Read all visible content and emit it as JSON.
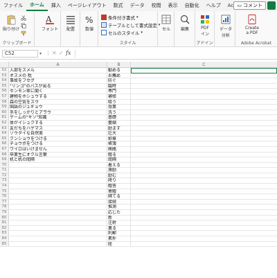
{
  "menu": {
    "items": [
      "ファイル",
      "ホーム",
      "挿入",
      "ページレイアウト",
      "数式",
      "データ",
      "校閲",
      "表示",
      "自動化",
      "ヘルプ",
      "Acrobat"
    ],
    "active_index": 1,
    "comment_label": "コメント"
  },
  "ribbon": {
    "clipboard": {
      "paste_label": "貼り付け",
      "group_label": "クリップボード"
    },
    "font": {
      "label": "フォント"
    },
    "alignment": {
      "label": "配置"
    },
    "number": {
      "label": "数値"
    },
    "styles": {
      "conditional": "条件付き書式",
      "table": "テーブルとして書式設定",
      "cellstyle": "セルのスタイル",
      "group_label": "スタイル"
    },
    "cells": {
      "label": "セル"
    },
    "editing": {
      "label": "編集"
    },
    "addin": {
      "label": "PDF\nイン",
      "group_label": "アドイン"
    },
    "analyze": {
      "label": "データ\n分析"
    },
    "acrobat": {
      "label": "Create\na PDF",
      "group_label": "Adobe Acrobat"
    }
  },
  "formula_bar": {
    "name_box": "C52",
    "fx": "fx",
    "value": ""
  },
  "columns": {
    "A": "A",
    "B": "B",
    "C": "C"
  },
  "rows": [
    {
      "n": "52",
      "a": "入部をスメル",
      "b": "勧める"
    },
    {
      "n": "53",
      "a": "オスメの 枕",
      "b": "お薦め"
    },
    {
      "n": "54",
      "a": "事故をフセグ",
      "b": "防ぐ"
    },
    {
      "n": "55",
      "a": "\"リンゴ\"のバスが出る",
      "b": "臨時"
    },
    {
      "n": "56",
      "a": "センモン家に聞く",
      "b": "専門"
    },
    {
      "n": "57",
      "a": "建物をホシュウする",
      "b": "補修"
    },
    {
      "n": "58",
      "a": "森の空気をスウ",
      "b": "吸う"
    },
    {
      "n": "59",
      "a": "国語のジュギョウ",
      "b": "授業"
    },
    {
      "n": "60",
      "a": "手をしっかりとアラウ",
      "b": "洗う"
    },
    {
      "n": "61",
      "a": "ゲームの\"キソ\"知識",
      "b": "基礎"
    },
    {
      "n": "62",
      "a": "体がイシュクする",
      "b": "萎縮"
    },
    {
      "n": "63",
      "a": "友だちをハゲマス",
      "b": "励ます"
    },
    {
      "n": "64",
      "a": "ソウダイな自然美",
      "b": "壮大"
    },
    {
      "n": "65",
      "a": "クンショウをつける",
      "b": "勲章"
    },
    {
      "n": "66",
      "a": "チョウボをつける",
      "b": "帳簿"
    },
    {
      "n": "67",
      "a": "ワイロはいけません",
      "b": "賄賂"
    },
    {
      "n": "68",
      "a": "卒業生にオクル言葉",
      "b": "贈る"
    },
    {
      "n": "69",
      "a": "机と机の間隔",
      "b": "間隔"
    },
    {
      "n": "70",
      "a": "",
      "b": "着える"
    },
    {
      "n": "71",
      "a": "",
      "b": "激励"
    },
    {
      "n": "72",
      "a": "",
      "b": "励む"
    },
    {
      "n": "73",
      "a": "",
      "b": "降り"
    },
    {
      "n": "74",
      "a": "",
      "b": "贈答"
    },
    {
      "n": "75",
      "a": "",
      "b": "寄贈"
    },
    {
      "n": "76",
      "a": "",
      "b": "隔てる"
    },
    {
      "n": "77",
      "a": "",
      "b": "接続"
    },
    {
      "n": "78",
      "a": "",
      "b": "推測"
    },
    {
      "n": "79",
      "a": "",
      "b": "応じた"
    },
    {
      "n": "80",
      "a": "",
      "b": "新"
    },
    {
      "n": "81",
      "a": "",
      "b": "注射"
    },
    {
      "n": "82",
      "a": "",
      "b": "裏る"
    },
    {
      "n": "83",
      "a": "",
      "b": "利郵"
    },
    {
      "n": "84",
      "a": "",
      "b": "素朴"
    },
    {
      "n": "85",
      "a": "",
      "b": "陸"
    }
  ]
}
